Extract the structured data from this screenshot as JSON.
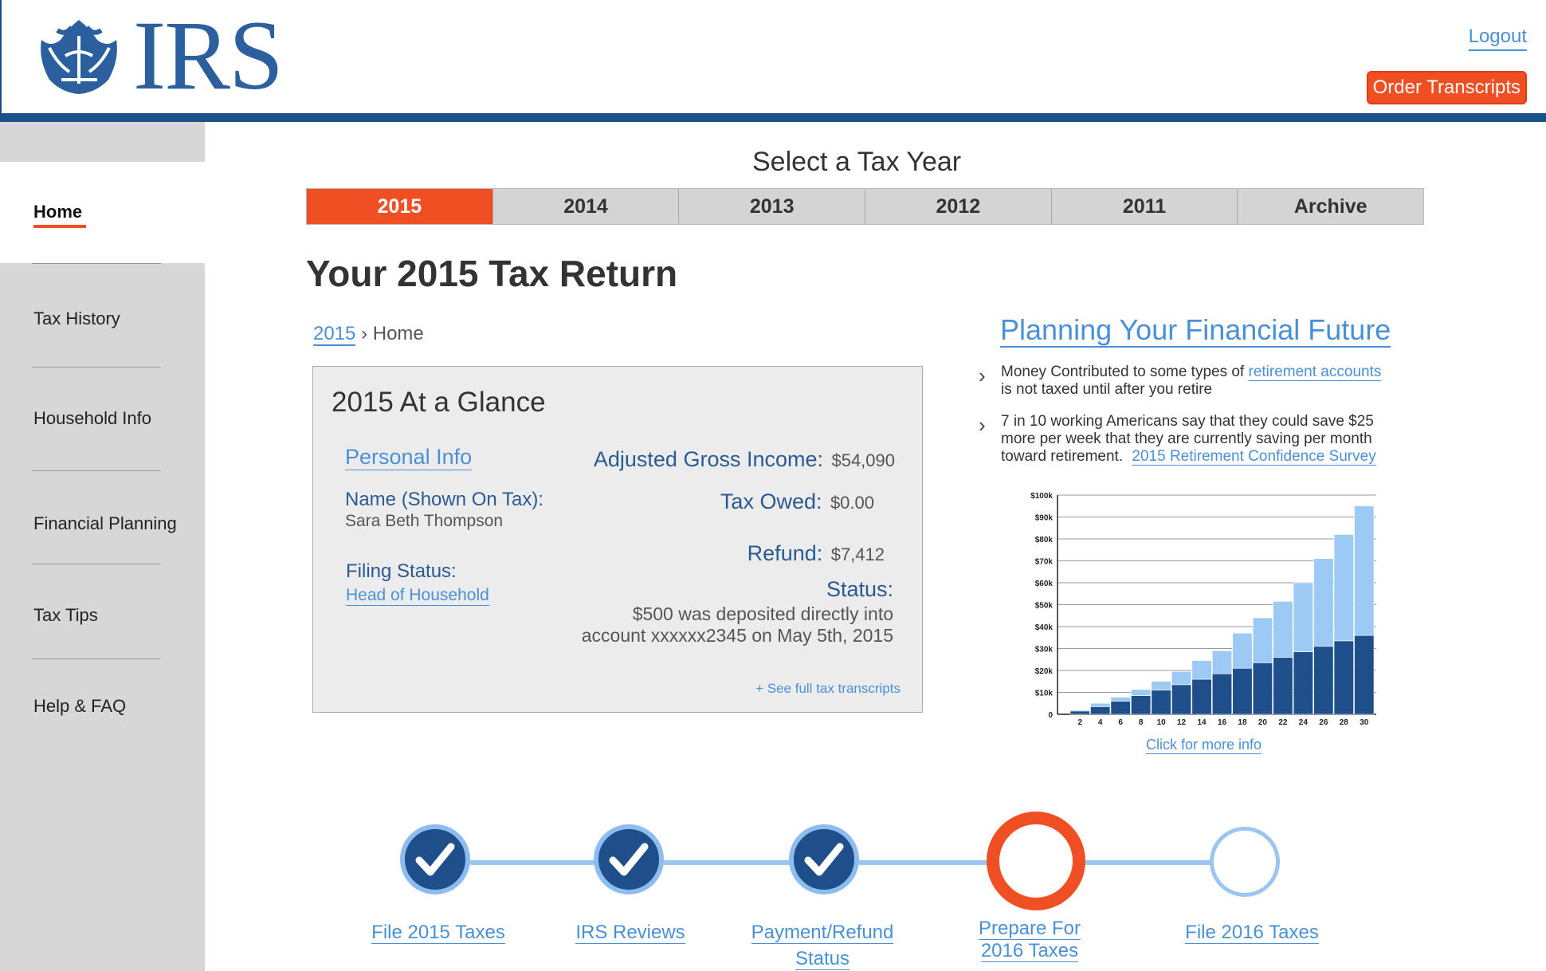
{
  "header": {
    "logo_text": "IRS",
    "logout": "Logout",
    "order_transcripts": "Order Transcripts"
  },
  "sidebar": {
    "items": [
      {
        "label": "Home"
      },
      {
        "label": "Tax History"
      },
      {
        "label": "Household Info"
      },
      {
        "label": "Financial Planning"
      },
      {
        "label": "Tax Tips"
      },
      {
        "label": "Help & FAQ"
      }
    ]
  },
  "year_selector": {
    "title": "Select a Tax Year",
    "tabs": [
      "2015",
      "2014",
      "2013",
      "2012",
      "2011",
      "Archive"
    ]
  },
  "main": {
    "title": "Your 2015 Tax Return",
    "breadcrumb_year": "2015",
    "breadcrumb_sep": "›",
    "breadcrumb_page": "Home"
  },
  "glance": {
    "title": "2015 At a Glance",
    "personal_info": "Personal Info",
    "name_label": "Name (Shown On Tax):",
    "name_value": "Sara Beth Thompson",
    "filing_label": "Filing Status:",
    "filing_value": "Head of Household",
    "agi_label": "Adjusted Gross Income:",
    "agi_value": "$54,090",
    "owed_label": "Tax Owed:",
    "owed_value": "$0.00",
    "refund_label": "Refund:",
    "refund_value": "$7,412",
    "status_label": "Status:",
    "status_line1": "$500 was deposited directly into",
    "status_line2": "account xxxxxx2345 on May 5th, 2015",
    "transcripts_link": "+ See full tax transcripts"
  },
  "planning": {
    "title": "Planning Your Financial Future",
    "bullet1_a": "Money Contributed to some types of",
    "bullet1_link": "retirement accounts",
    "bullet1_b": "is not taxed until after you retire",
    "bullet2_a": "7 in 10 working Americans say that they could save $25",
    "bullet2_b": "more per week that they are currently saving per month",
    "bullet2_c": "toward retirement.",
    "bullet2_link": "2015 Retirement Confidence Survey",
    "chart_link": "Click for more info"
  },
  "chart_data": {
    "type": "bar",
    "stacked": true,
    "categories": [
      "2",
      "4",
      "6",
      "8",
      "10",
      "12",
      "14",
      "16",
      "18",
      "20",
      "22",
      "24",
      "26",
      "28",
      "30"
    ],
    "series": [
      {
        "color": "#1e4f8a",
        "values": [
          1.5,
          3.5,
          6,
          8.5,
          11,
          13.5,
          16,
          18.5,
          21,
          23.5,
          26,
          28.5,
          31,
          33.5,
          36
        ]
      },
      {
        "color": "#9ccaf5",
        "values": [
          0.5,
          1.5,
          1.8,
          2.8,
          4,
          6,
          8.5,
          10.5,
          16,
          20.5,
          25.5,
          31.5,
          40,
          48.5,
          59
        ]
      }
    ],
    "ylim": [
      0,
      100
    ],
    "y_ticks": [
      "0",
      "$10k",
      "$20k",
      "$30k",
      "$40k",
      "$50k",
      "$60k",
      "$70k",
      "$80k",
      "$90k",
      "$100k"
    ],
    "grid": true
  },
  "progress": {
    "steps": [
      {
        "label_line1": "File 2015 Taxes",
        "label_line2": "",
        "state": "done"
      },
      {
        "label_line1": "IRS Reviews",
        "label_line2": "",
        "state": "done"
      },
      {
        "label_line1": "Payment/Refund",
        "label_line2": "Status",
        "state": "done"
      },
      {
        "label_line1": "Prepare For",
        "label_line2": "2016 Taxes",
        "state": "current"
      },
      {
        "label_line1": "File 2016 Taxes",
        "label_line2": "",
        "state": "todo"
      }
    ]
  },
  "colors": {
    "accent": "#f04e23",
    "navy": "#1d4f89",
    "link": "#4a90d9",
    "light_blue": "#9bc6f2"
  }
}
